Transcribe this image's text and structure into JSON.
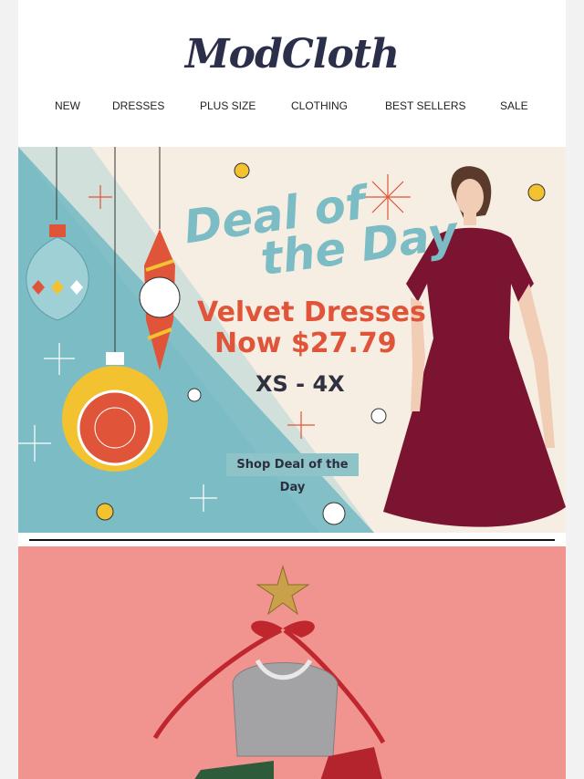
{
  "brand": {
    "logo_text": "ModCloth"
  },
  "nav": {
    "items": [
      {
        "label": "NEW"
      },
      {
        "label": "DRESSES"
      },
      {
        "label": "PLUS SIZE"
      },
      {
        "label": "CLOTHING"
      },
      {
        "label": "BEST SELLERS"
      },
      {
        "label": "SALE"
      }
    ]
  },
  "hero": {
    "headline_line1": "Deal of",
    "headline_line2": "the Day",
    "subhead": "Velvet Dresses",
    "price": "Now $27.79",
    "sizes": "XS - 4X",
    "cta_label": "Shop Deal of the Day",
    "colors": {
      "teal": "#7cbcc4",
      "coral": "#e0553a",
      "dress": "#7a1430",
      "background": "#f6eee2"
    }
  },
  "promo2": {
    "colors": {
      "background": "#f1948f",
      "ribbon": "#c0262d",
      "star": "#c9a14a"
    }
  }
}
